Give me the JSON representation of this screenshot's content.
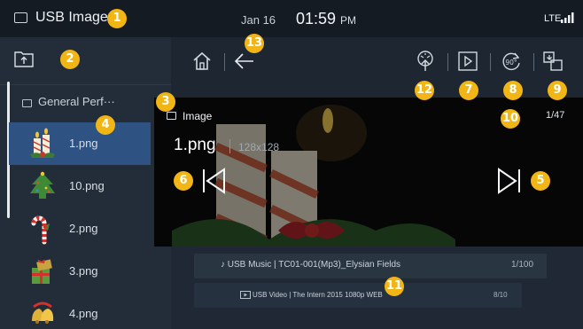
{
  "status_bar": {
    "title": "USB Image",
    "date": "Jan 16",
    "time": "01:59",
    "ampm": "PM",
    "network": "LTE"
  },
  "badges": {
    "b1": "1",
    "b2": "2",
    "b3": "3",
    "b4": "4",
    "b5": "5",
    "b6": "6",
    "b7": "7",
    "b8": "8",
    "b9": "9",
    "b10": "10",
    "b11": "11",
    "b12": "12",
    "b13": "13"
  },
  "sidebar": {
    "folder_label": "General Perf···",
    "files": [
      {
        "label": "1.png",
        "selected": true,
        "thumb": "candles-icon"
      },
      {
        "label": "10.png",
        "selected": false,
        "thumb": "christmas-tree-icon"
      },
      {
        "label": "2.png",
        "selected": false,
        "thumb": "candy-cane-icon"
      },
      {
        "label": "3.png",
        "selected": false,
        "thumb": "gift-box-icon"
      },
      {
        "label": "4.png",
        "selected": false,
        "thumb": "bells-icon"
      }
    ]
  },
  "toolbar": {
    "icons": [
      "home-icon",
      "back-arrow-icon",
      "upload-icon",
      "play-slideshow-icon",
      "rotate-90-icon",
      "copy-icon"
    ],
    "rotate_label": "90°"
  },
  "viewer": {
    "breadcrumb": "Image",
    "counter": "1/47",
    "file_name": "1.png",
    "dimensions": "128x128"
  },
  "media_cards": {
    "music": {
      "text": "USB Music | TC01-001(Mp3)_Elysian Fields",
      "count": "1/100"
    },
    "video": {
      "text": "USB Video | The Intern 2015 1080p WEB",
      "count": "8/10"
    }
  },
  "colors": {
    "accent_badge": "#f1b615",
    "selected_row": "#2e5383",
    "background": "#1d2631"
  }
}
